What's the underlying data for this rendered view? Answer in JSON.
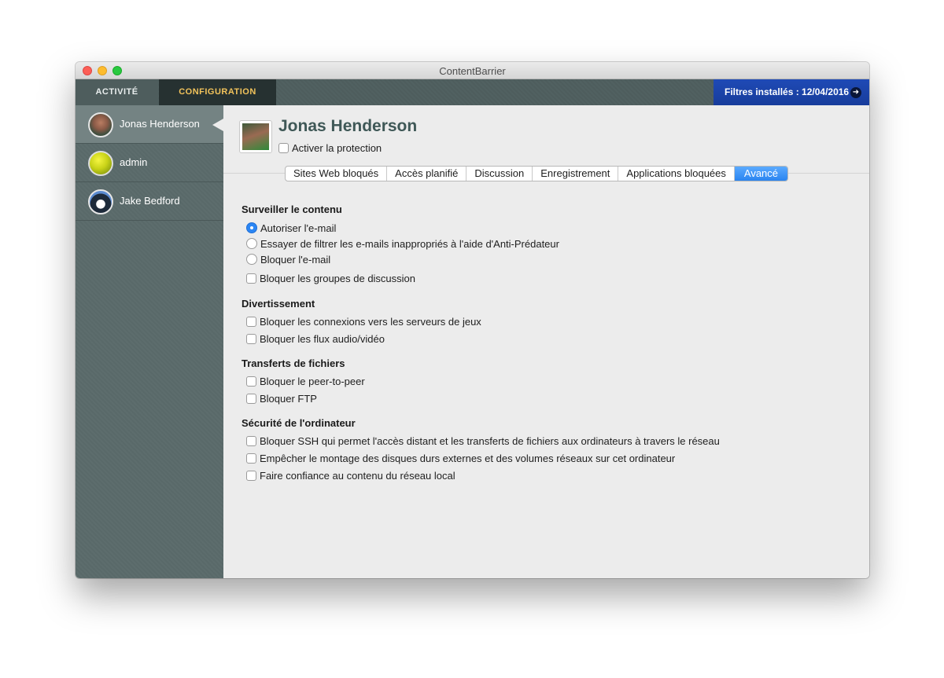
{
  "window": {
    "title": "ContentBarrier"
  },
  "tabs": {
    "activite": "ACTIVITÉ",
    "configuration": "CONFIGURATION"
  },
  "filters": {
    "label": "Filtres installés : 12/04/2016",
    "arrow_icon": "arrow-right-circle-icon"
  },
  "sidebar": {
    "users": [
      {
        "name": "Jonas Henderson",
        "selected": true
      },
      {
        "name": "admin",
        "selected": false
      },
      {
        "name": "Jake Bedford",
        "selected": false
      }
    ]
  },
  "main": {
    "user_name": "Jonas Henderson",
    "protection_label": "Activer la protection",
    "protection_checked": false,
    "subtabs": [
      "Sites Web bloqués",
      "Accès planifié",
      "Discussion",
      "Enregistrement",
      "Applications bloquées",
      "Avancé"
    ],
    "active_subtab": "Avancé"
  },
  "sections": {
    "contenu": {
      "title": "Surveiller le contenu",
      "radio_options": [
        "Autoriser l'e-mail",
        "Essayer de filtrer les e-mails inappropriés à l'aide d'Anti-Prédateur",
        "Bloquer l'e-mail"
      ],
      "selected_radio": "Autoriser l'e-mail",
      "checkbox": "Bloquer les groupes de discussion"
    },
    "divertissement": {
      "title": "Divertissement",
      "checkboxes": [
        "Bloquer les connexions vers les serveurs de jeux",
        "Bloquer les flux audio/vidéo"
      ]
    },
    "transferts": {
      "title": "Transferts de fichiers",
      "checkboxes": [
        "Bloquer le peer-to-peer",
        "Bloquer FTP"
      ]
    },
    "securite": {
      "title": "Sécurité de l'ordinateur",
      "checkboxes": [
        "Bloquer SSH qui permet l'accès distant et les transferts de fichiers aux ordinateurs à travers le réseau",
        "Empêcher le montage des disques durs externes et des volumes réseaux sur cet ordinateur",
        "Faire confiance au contenu du réseau local"
      ]
    }
  },
  "colors": {
    "accent": "#2b86f4",
    "config_tab_text": "#f2c35b",
    "filters_bg": "#1f4ab6"
  }
}
